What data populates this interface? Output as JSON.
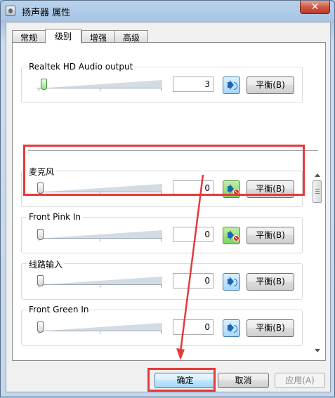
{
  "window": {
    "title": "扬声器 属性",
    "close_glyph": "✕"
  },
  "tabs": [
    {
      "label": "常规",
      "active": false
    },
    {
      "label": "级别",
      "active": true
    },
    {
      "label": "增强",
      "active": false
    },
    {
      "label": "高级",
      "active": false
    }
  ],
  "output": {
    "label": "Realtek HD Audio output",
    "value": "3",
    "level_percent": 3,
    "balance_label": "平衡(B)"
  },
  "inputs": [
    {
      "label": "麦克风",
      "value": "0",
      "level_percent": 0,
      "muted": true,
      "balance_label": "平衡(B)"
    },
    {
      "label": "Front Pink In",
      "value": "0",
      "level_percent": 0,
      "muted": true,
      "balance_label": "平衡(B)"
    },
    {
      "label": "线路输入",
      "value": "0",
      "level_percent": 0,
      "muted": false,
      "balance_label": "平衡(B)"
    },
    {
      "label": "Front Green In",
      "value": "0",
      "level_percent": 0,
      "muted": false,
      "balance_label": "平衡(B)"
    }
  ],
  "buttons": {
    "ok": "确定",
    "cancel": "取消",
    "apply": "应用(A)"
  },
  "annotation_color": "#e53a3a"
}
